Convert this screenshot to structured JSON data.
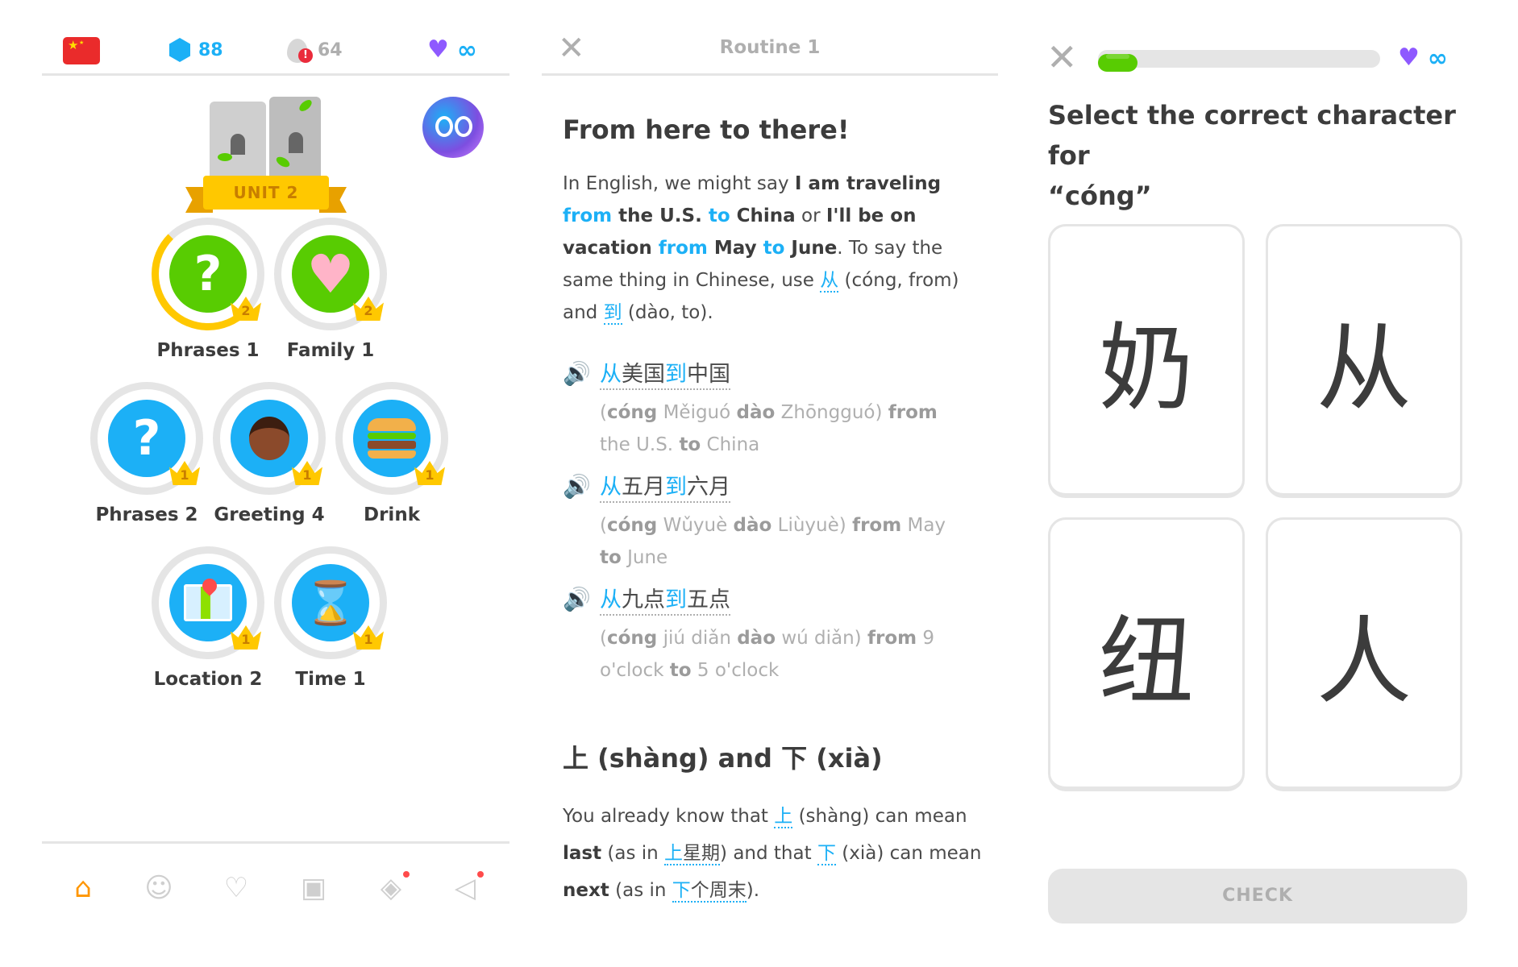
{
  "map": {
    "flag_icon": "china-flag-icon",
    "gems": "88",
    "streak": "64",
    "hearts": "∞",
    "unit_label": "UNIT 2",
    "skills": [
      {
        "label": "Phrases 1",
        "level": "2",
        "icon": "question-icon",
        "color": "#58cc02",
        "progress": 0.35
      },
      {
        "label": "Family 1",
        "level": "2",
        "icon": "heart-face-icon",
        "color": "#58cc02"
      },
      {
        "label": "Phrases 2",
        "level": "1",
        "icon": "question-icon",
        "color": "#1cb0f6"
      },
      {
        "label": "Greeting 4",
        "level": "1",
        "icon": "person-icon",
        "color": "#1cb0f6"
      },
      {
        "label": "Drink",
        "level": "1",
        "icon": "burger-icon",
        "color": "#1cb0f6"
      },
      {
        "label": "Location 2",
        "level": "1",
        "icon": "map-icon",
        "color": "#1cb0f6"
      },
      {
        "label": "Time 1",
        "level": "1",
        "icon": "hourglass-icon",
        "color": "#1cb0f6"
      }
    ],
    "nav": [
      "home-icon",
      "characters-icon",
      "practice-icon",
      "shop-icon",
      "league-icon",
      "news-icon"
    ]
  },
  "tips": {
    "title": "Routine 1",
    "heading1": "From here to there!",
    "intro": {
      "t1": "In English, we might say ",
      "b1": "I am traveling ",
      "h1": "from",
      "b2": " the U.S. ",
      "h2": "to",
      "b3": " China",
      "t2": " or ",
      "b4": "I'll be on vacation ",
      "h3": "from",
      "b5": " May ",
      "h4": "to",
      "b6": " June",
      "t3": ". To say the same thing in Chinese, use ",
      "z1": "从",
      "t4": " (cóng, from) and ",
      "z2": "到",
      "t5": " (dào, to)."
    },
    "examples": [
      {
        "c1": "从",
        "m1": "美国",
        "c2": "到",
        "m2": "中国",
        "p1": "(",
        "pb1": "cóng",
        "p2": " Měiguó ",
        "pb2": "dào",
        "p3": " Zhōngguó) ",
        "e1": "from",
        "p4": " the U.S. ",
        "e2": "to",
        "p5": " China"
      },
      {
        "c1": "从",
        "m1": "五月",
        "c2": "到",
        "m2": "六月",
        "p1": "(",
        "pb1": "cóng",
        "p2": " Wǔyuè ",
        "pb2": "dào",
        "p3": " Liùyuè) ",
        "e1": "from",
        "p4": " May ",
        "e2": "to",
        "p5": " June"
      },
      {
        "c1": "从",
        "m1": "九点",
        "c2": "到",
        "m2": "五点",
        "p1": "(",
        "pb1": "cóng",
        "p2": " jiú diǎn ",
        "pb2": "dào",
        "p3": " wú diǎn) ",
        "e1": "from",
        "p4": " 9 o'clock ",
        "e2": "to",
        "p5": " 5 o'clock"
      }
    ],
    "heading2": "上 (shàng) and 下 (xià)",
    "outro": {
      "t1": "You already know that ",
      "z1": "上",
      "t2": " (shàng) can mean ",
      "b1": "last",
      "t3": " (as in ",
      "z2": "上",
      "z2b": "星期",
      "t4": ") and that ",
      "z3": "下",
      "t5": " (xià) can mean ",
      "b2": "next",
      "t6": " (as in ",
      "z4": "下",
      "z4b": "个周末",
      "t7": ")."
    }
  },
  "exercise": {
    "progress": 0.14,
    "hearts": "∞",
    "prompt_line1": "Select the correct character for",
    "prompt_line2": "“cóng”",
    "choices": [
      "奶",
      "从",
      "纽",
      "人"
    ],
    "check_label": "CHECK"
  },
  "colors": {
    "accent": "#1cb0f6",
    "success": "#58cc02",
    "gold": "#ffc800",
    "muted": "#afafaf"
  }
}
